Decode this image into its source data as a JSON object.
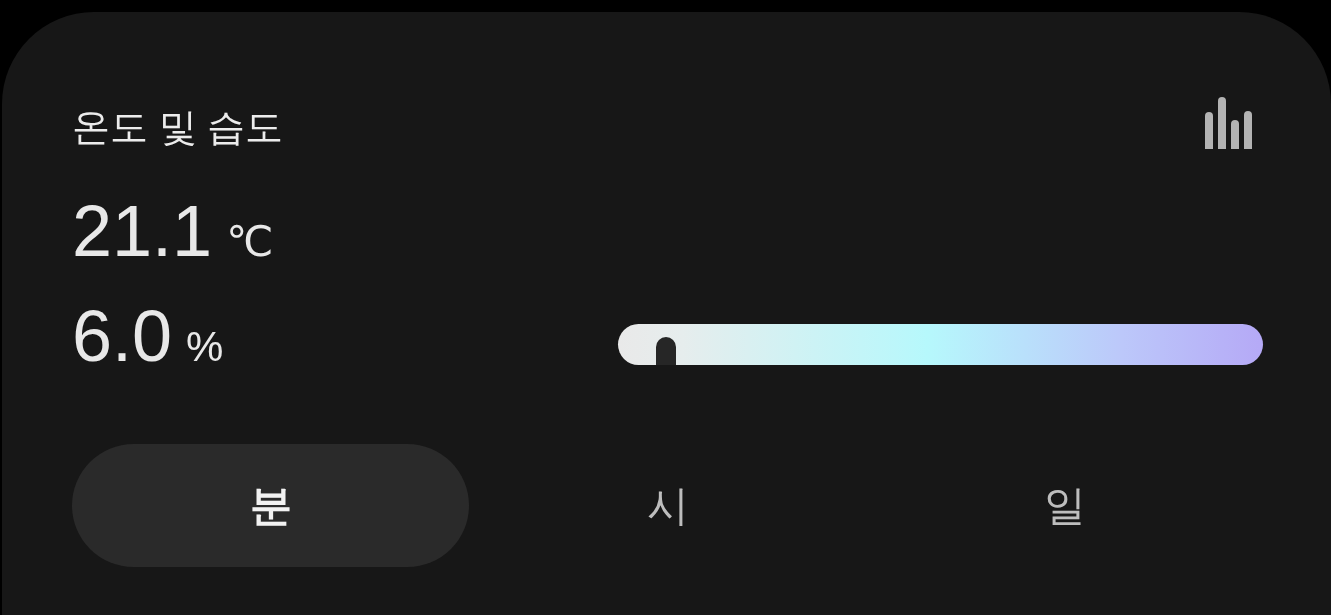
{
  "title": "온도 및 습도",
  "readings": [
    {
      "value": "21.1",
      "unit": "℃"
    },
    {
      "value": "6.0",
      "unit": "%",
      "gauge": {
        "level": 0.075
      }
    }
  ],
  "tabs": [
    {
      "label": "분",
      "selected": true
    },
    {
      "label": "시",
      "selected": false
    },
    {
      "label": "일",
      "selected": false
    }
  ]
}
